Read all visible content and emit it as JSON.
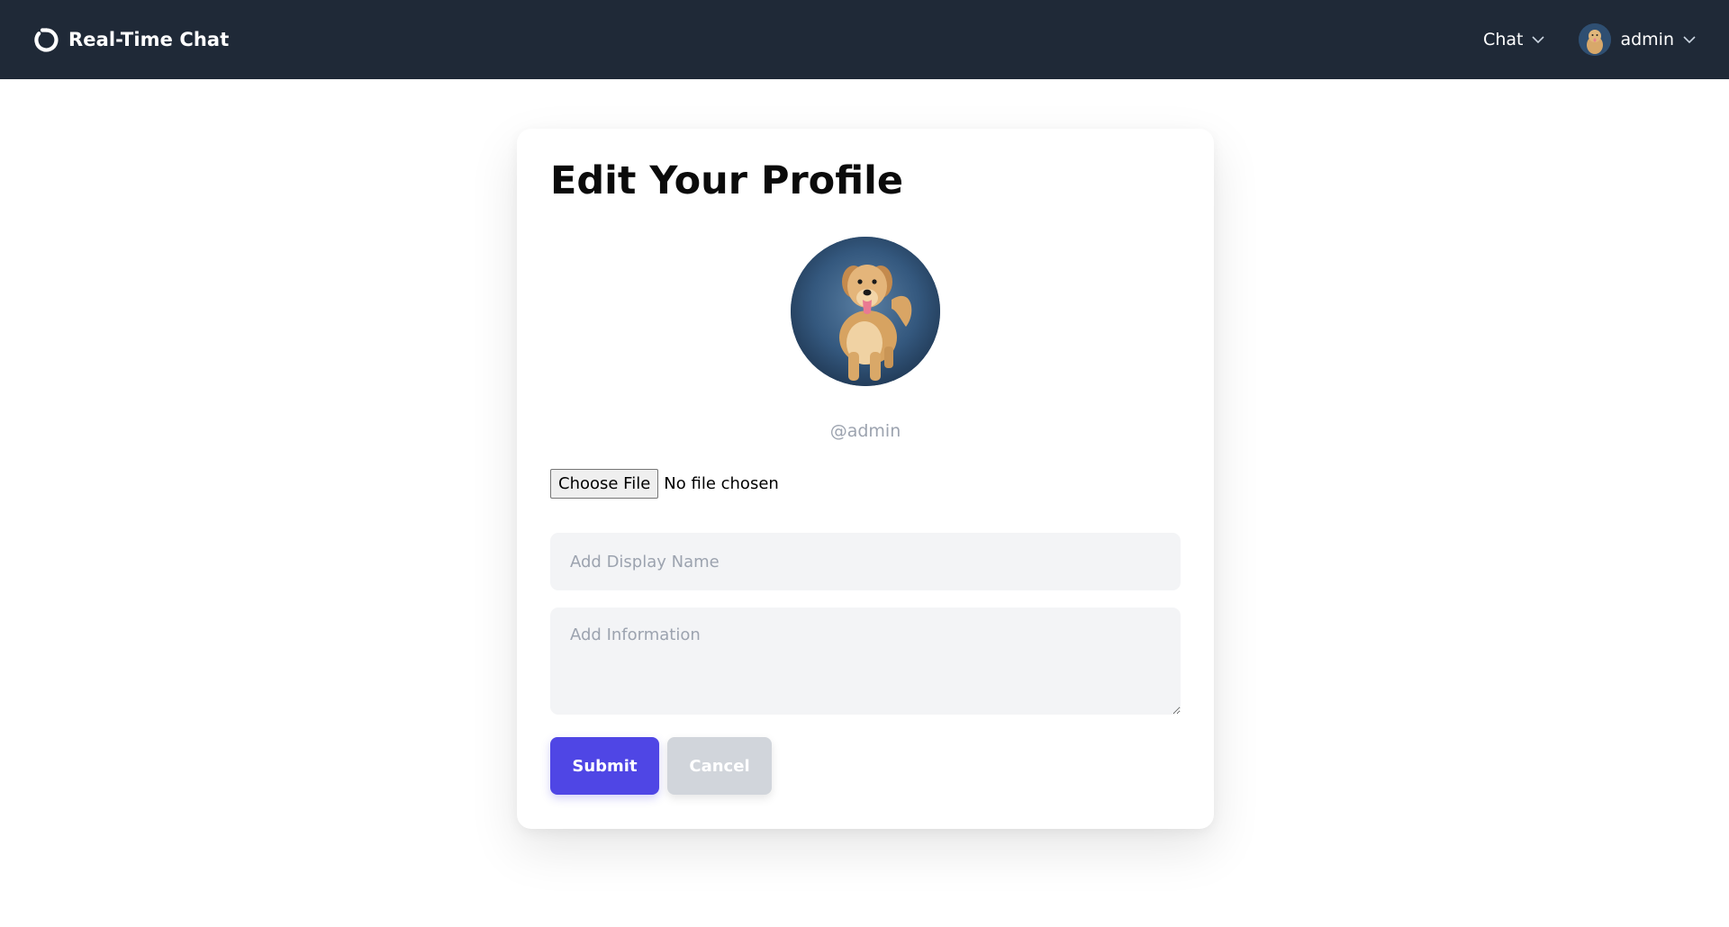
{
  "navbar": {
    "brand_title": "Real-Time Chat",
    "brand_icon": "circle-refresh-icon",
    "chat_label": "Chat",
    "user_label": "admin"
  },
  "profile": {
    "title": "Edit Your Profile",
    "handle": "@admin",
    "file_button": "Choose File",
    "file_status": "No file chosen",
    "display_name_placeholder": "Add Display Name",
    "information_placeholder": "Add Information",
    "submit_label": "Submit",
    "cancel_label": "Cancel"
  },
  "colors": {
    "navbar_bg": "#1f2937",
    "primary": "#4f46e5",
    "cancel_bg": "#d1d5db",
    "input_bg": "#f3f4f6"
  }
}
